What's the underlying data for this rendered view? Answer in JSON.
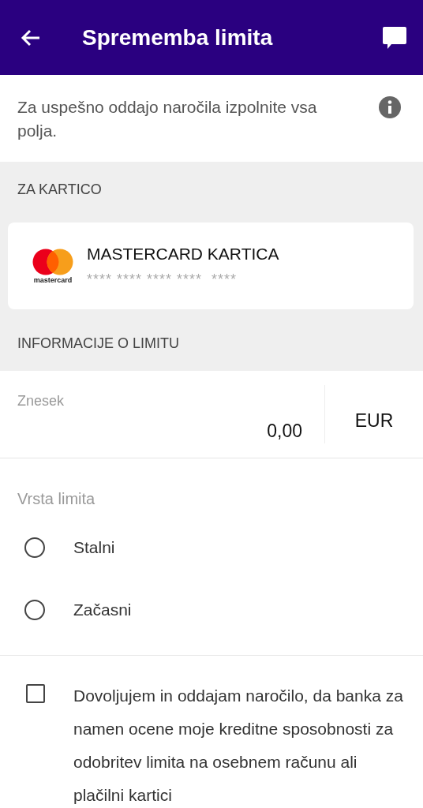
{
  "header": {
    "title": "Sprememba limita"
  },
  "notice": {
    "text": "Za uspešno oddajo naročila izpolnite vsa polja."
  },
  "card_section": {
    "title": "ZA KARTICO"
  },
  "card": {
    "logo_text": "mastercard",
    "name": "MASTERCARD KARTICA",
    "number": "**** **** **** ****  ****"
  },
  "limit_section": {
    "title": "INFORMACIJE O LIMITU"
  },
  "amount": {
    "label": "Znesek",
    "value": "0,00",
    "currency": "EUR"
  },
  "limit_type": {
    "label": "Vrsta limita",
    "options": [
      {
        "label": "Stalni",
        "selected": false
      },
      {
        "label": "Začasni",
        "selected": false
      }
    ]
  },
  "consent": {
    "checked": false,
    "text": "Dovoljujem in oddajam naročilo, da banka za namen ocene moje kreditne sposobnosti za odobritev limita na osebnem računu ali plačilni kartici"
  }
}
